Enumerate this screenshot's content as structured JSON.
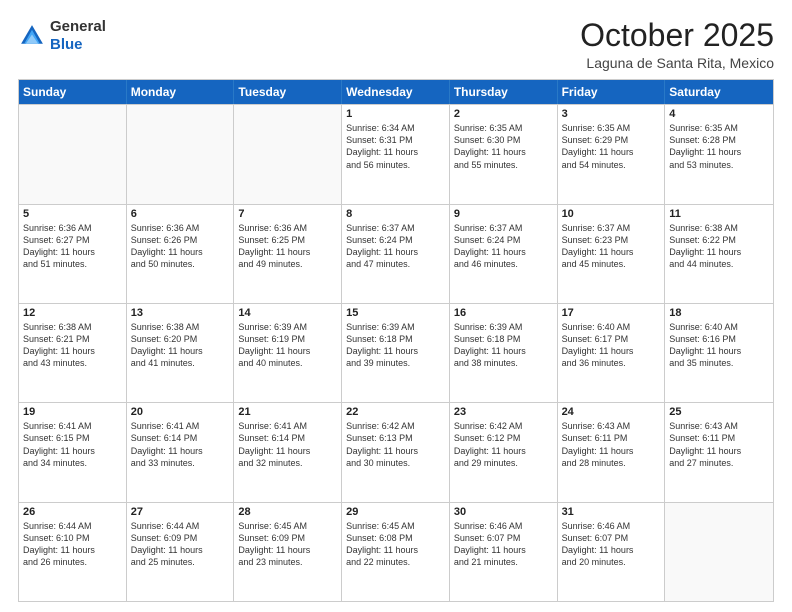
{
  "logo": {
    "general": "General",
    "blue": "Blue"
  },
  "header": {
    "month": "October 2025",
    "location": "Laguna de Santa Rita, Mexico"
  },
  "weekdays": [
    "Sunday",
    "Monday",
    "Tuesday",
    "Wednesday",
    "Thursday",
    "Friday",
    "Saturday"
  ],
  "weeks": [
    [
      {
        "day": "",
        "info": ""
      },
      {
        "day": "",
        "info": ""
      },
      {
        "day": "",
        "info": ""
      },
      {
        "day": "1",
        "info": "Sunrise: 6:34 AM\nSunset: 6:31 PM\nDaylight: 11 hours\nand 56 minutes."
      },
      {
        "day": "2",
        "info": "Sunrise: 6:35 AM\nSunset: 6:30 PM\nDaylight: 11 hours\nand 55 minutes."
      },
      {
        "day": "3",
        "info": "Sunrise: 6:35 AM\nSunset: 6:29 PM\nDaylight: 11 hours\nand 54 minutes."
      },
      {
        "day": "4",
        "info": "Sunrise: 6:35 AM\nSunset: 6:28 PM\nDaylight: 11 hours\nand 53 minutes."
      }
    ],
    [
      {
        "day": "5",
        "info": "Sunrise: 6:36 AM\nSunset: 6:27 PM\nDaylight: 11 hours\nand 51 minutes."
      },
      {
        "day": "6",
        "info": "Sunrise: 6:36 AM\nSunset: 6:26 PM\nDaylight: 11 hours\nand 50 minutes."
      },
      {
        "day": "7",
        "info": "Sunrise: 6:36 AM\nSunset: 6:25 PM\nDaylight: 11 hours\nand 49 minutes."
      },
      {
        "day": "8",
        "info": "Sunrise: 6:37 AM\nSunset: 6:24 PM\nDaylight: 11 hours\nand 47 minutes."
      },
      {
        "day": "9",
        "info": "Sunrise: 6:37 AM\nSunset: 6:24 PM\nDaylight: 11 hours\nand 46 minutes."
      },
      {
        "day": "10",
        "info": "Sunrise: 6:37 AM\nSunset: 6:23 PM\nDaylight: 11 hours\nand 45 minutes."
      },
      {
        "day": "11",
        "info": "Sunrise: 6:38 AM\nSunset: 6:22 PM\nDaylight: 11 hours\nand 44 minutes."
      }
    ],
    [
      {
        "day": "12",
        "info": "Sunrise: 6:38 AM\nSunset: 6:21 PM\nDaylight: 11 hours\nand 43 minutes."
      },
      {
        "day": "13",
        "info": "Sunrise: 6:38 AM\nSunset: 6:20 PM\nDaylight: 11 hours\nand 41 minutes."
      },
      {
        "day": "14",
        "info": "Sunrise: 6:39 AM\nSunset: 6:19 PM\nDaylight: 11 hours\nand 40 minutes."
      },
      {
        "day": "15",
        "info": "Sunrise: 6:39 AM\nSunset: 6:18 PM\nDaylight: 11 hours\nand 39 minutes."
      },
      {
        "day": "16",
        "info": "Sunrise: 6:39 AM\nSunset: 6:18 PM\nDaylight: 11 hours\nand 38 minutes."
      },
      {
        "day": "17",
        "info": "Sunrise: 6:40 AM\nSunset: 6:17 PM\nDaylight: 11 hours\nand 36 minutes."
      },
      {
        "day": "18",
        "info": "Sunrise: 6:40 AM\nSunset: 6:16 PM\nDaylight: 11 hours\nand 35 minutes."
      }
    ],
    [
      {
        "day": "19",
        "info": "Sunrise: 6:41 AM\nSunset: 6:15 PM\nDaylight: 11 hours\nand 34 minutes."
      },
      {
        "day": "20",
        "info": "Sunrise: 6:41 AM\nSunset: 6:14 PM\nDaylight: 11 hours\nand 33 minutes."
      },
      {
        "day": "21",
        "info": "Sunrise: 6:41 AM\nSunset: 6:14 PM\nDaylight: 11 hours\nand 32 minutes."
      },
      {
        "day": "22",
        "info": "Sunrise: 6:42 AM\nSunset: 6:13 PM\nDaylight: 11 hours\nand 30 minutes."
      },
      {
        "day": "23",
        "info": "Sunrise: 6:42 AM\nSunset: 6:12 PM\nDaylight: 11 hours\nand 29 minutes."
      },
      {
        "day": "24",
        "info": "Sunrise: 6:43 AM\nSunset: 6:11 PM\nDaylight: 11 hours\nand 28 minutes."
      },
      {
        "day": "25",
        "info": "Sunrise: 6:43 AM\nSunset: 6:11 PM\nDaylight: 11 hours\nand 27 minutes."
      }
    ],
    [
      {
        "day": "26",
        "info": "Sunrise: 6:44 AM\nSunset: 6:10 PM\nDaylight: 11 hours\nand 26 minutes."
      },
      {
        "day": "27",
        "info": "Sunrise: 6:44 AM\nSunset: 6:09 PM\nDaylight: 11 hours\nand 25 minutes."
      },
      {
        "day": "28",
        "info": "Sunrise: 6:45 AM\nSunset: 6:09 PM\nDaylight: 11 hours\nand 23 minutes."
      },
      {
        "day": "29",
        "info": "Sunrise: 6:45 AM\nSunset: 6:08 PM\nDaylight: 11 hours\nand 22 minutes."
      },
      {
        "day": "30",
        "info": "Sunrise: 6:46 AM\nSunset: 6:07 PM\nDaylight: 11 hours\nand 21 minutes."
      },
      {
        "day": "31",
        "info": "Sunrise: 6:46 AM\nSunset: 6:07 PM\nDaylight: 11 hours\nand 20 minutes."
      },
      {
        "day": "",
        "info": ""
      }
    ]
  ]
}
